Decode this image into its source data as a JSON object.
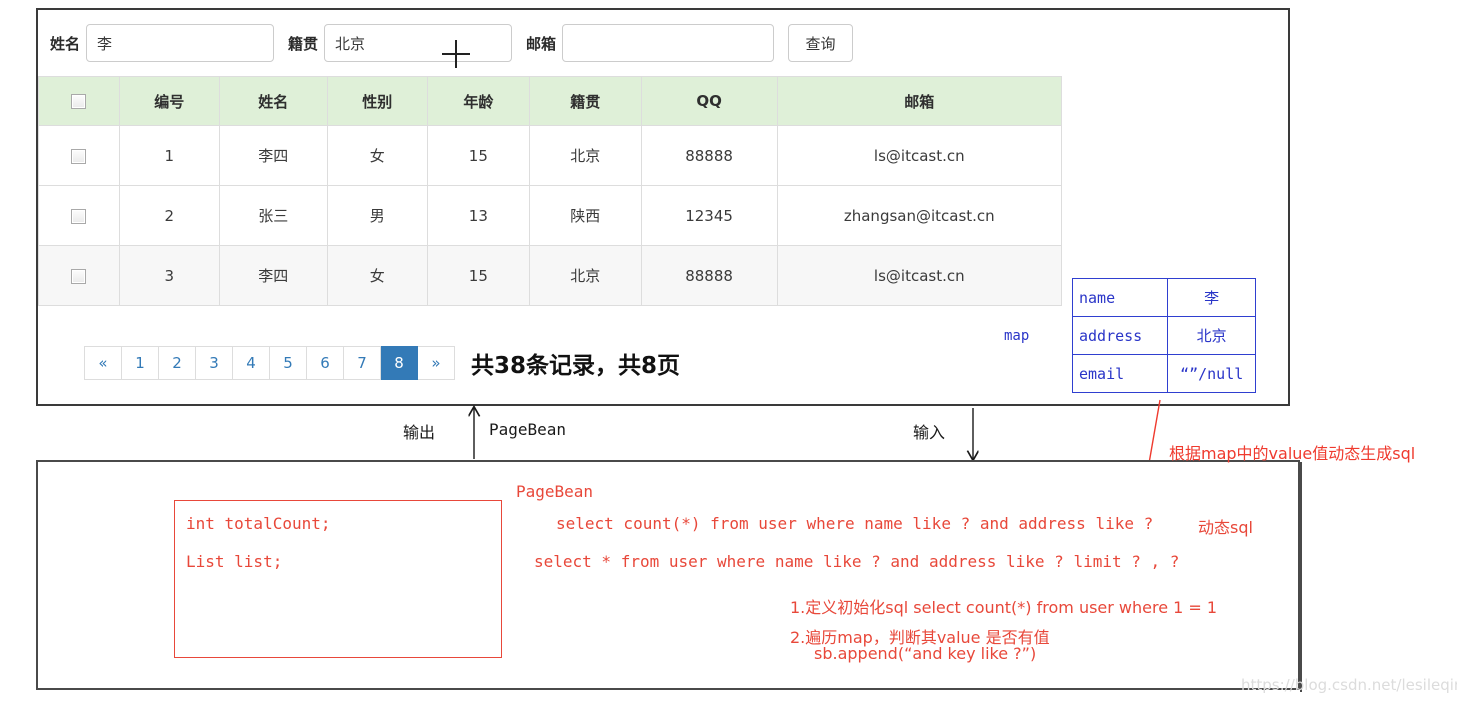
{
  "search_form": {
    "name_label": "姓名",
    "name_value": "李",
    "origin_label": "籍贯",
    "origin_value": "北京",
    "email_label": "邮箱",
    "email_value": "",
    "email_placeholder": "",
    "query_button": "查询"
  },
  "table": {
    "headers": [
      "",
      "编号",
      "姓名",
      "性别",
      "年龄",
      "籍贯",
      "QQ",
      "邮箱"
    ],
    "rows": [
      {
        "id": "1",
        "name": "李四",
        "gender": "女",
        "age": "15",
        "origin": "北京",
        "qq": "88888",
        "email": "ls@itcast.cn"
      },
      {
        "id": "2",
        "name": "张三",
        "gender": "男",
        "age": "13",
        "origin": "陕西",
        "qq": "12345",
        "email": "zhangsan@itcast.cn"
      },
      {
        "id": "3",
        "name": "李四",
        "gender": "女",
        "age": "15",
        "origin": "北京",
        "qq": "88888",
        "email": "ls@itcast.cn"
      }
    ]
  },
  "pagination": {
    "prev": "«",
    "pages": [
      "1",
      "2",
      "3",
      "4",
      "5",
      "6",
      "7",
      "8"
    ],
    "active_page": "8",
    "next": "»",
    "summary": "共38条记录，共8页"
  },
  "map": {
    "label": "map",
    "rows": [
      {
        "key": "name",
        "value": "李"
      },
      {
        "key": "address",
        "value": "北京"
      },
      {
        "key": "email",
        "value": "“”/null"
      }
    ]
  },
  "flow": {
    "output_label": "输出",
    "input_label": "输入",
    "pagebean_label": "PageBean"
  },
  "pagebean": {
    "title": "PageBean",
    "field_total": "int totalCount;",
    "field_list": "List list;",
    "sql_count": "select count(*) from user where name like ? and address like ?",
    "sql_select": "select * from user where name like ? and address like ? limit ? , ?",
    "dynamic_sql_label": "动态sql"
  },
  "notes": {
    "line1": "1.定义初始化sql select count(*) from user where 1 = 1",
    "line2": "2.遍历map，判断其value 是否有值",
    "line3": "sb.append(“and  key like ?”)"
  },
  "annotation": {
    "dynamic_generation": "根据map中的value值动态生成sql"
  },
  "watermark": "https://blog.csdn.net/lesileqin",
  "colors": {
    "table_header_bg": "#dff0d8",
    "pagination_active": "#337ab7",
    "map_blue": "#2a35c8",
    "annotation_red": "#e8483a",
    "panel_border": "#3a3a3a"
  }
}
